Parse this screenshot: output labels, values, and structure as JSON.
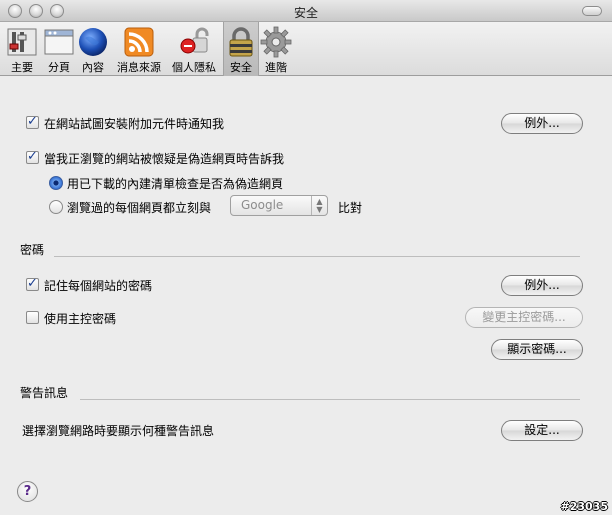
{
  "window": {
    "title": "安全"
  },
  "toolbar": {
    "items": [
      {
        "label": "主要",
        "icon": "general-switches-icon"
      },
      {
        "label": "分頁",
        "icon": "tabs-icon"
      },
      {
        "label": "內容",
        "icon": "globe-icon"
      },
      {
        "label": "消息來源",
        "icon": "rss-icon"
      },
      {
        "label": "個人隱私",
        "icon": "privacy-lock-icon"
      },
      {
        "label": "安全",
        "icon": "security-padlock-icon"
      },
      {
        "label": "進階",
        "icon": "gear-icon"
      }
    ],
    "selected": "安全"
  },
  "general": {
    "addon_warning": {
      "label": "在網站試圖安裝附加元件時通知我",
      "checked": true
    },
    "addon_exceptions_label": "例外...",
    "phishing_warning": {
      "label": "當我正瀏覽的網站被懷疑是偽造網頁時告訴我",
      "checked": true
    },
    "phishing_local": {
      "label": "用已下載的內建清單檢查是否為偽造網頁",
      "selected": true
    },
    "phishing_online": {
      "label": "瀏覽過的每個網頁都立刻與",
      "selected": false
    },
    "phishing_provider": "Google",
    "phishing_compare": "比對"
  },
  "passwords": {
    "title": "密碼",
    "remember": {
      "label": "記住每個網站的密碼",
      "checked": true
    },
    "exceptions_label": "例外...",
    "master": {
      "label": "使用主控密碼",
      "checked": false
    },
    "change_master_label": "變更主控密碼...",
    "show_label": "顯示密碼..."
  },
  "warnings": {
    "title": "警告訊息",
    "description": "選擇瀏覽網路時要顯示何種警告訊息",
    "settings_label": "設定..."
  },
  "help": {
    "label": "?"
  },
  "watermark": "#23035",
  "colors": {
    "accent": "#2f6bd1",
    "window_bg": "#ececec"
  }
}
